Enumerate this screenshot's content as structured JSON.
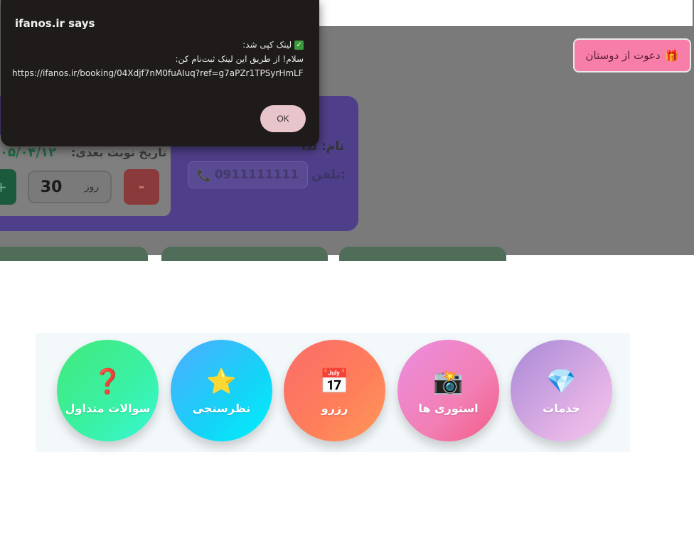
{
  "alert": {
    "title": "ifanos.ir says",
    "line1": "لینک کپی شد:",
    "line1_icon": "check-mark-icon",
    "line2": "سلام! از طریق این لینک ثبت‌نام کن:",
    "url": "https://ifanos.ir/booking/04Xdjf7nM0fuAIuq?ref=g7aPZr1TPSyrHmLF",
    "ok_label": "OK"
  },
  "invite": {
    "label": "دعوت از دوستان",
    "icon": "gift-icon"
  },
  "profile": {
    "name_label": "نام:",
    "name_value": "لدا",
    "phone_label": "تلفن:",
    "phone_value": "0911111111",
    "phone_icon": "phone-icon"
  },
  "next_appointment": {
    "label": "تاریخ نوبت بعدی:",
    "date": "۰۵/۰۴/۱۲",
    "days_value": "30",
    "days_unit": "روز",
    "minus_label": "-",
    "plus_label": "+"
  },
  "menu": {
    "items": [
      {
        "label": "خدمات",
        "icon": "gem-icon",
        "glyph": "💎"
      },
      {
        "label": "استوری ها",
        "icon": "camera-icon",
        "glyph": "📸"
      },
      {
        "label": "رزرو",
        "icon": "calendar-icon",
        "glyph": "📅"
      },
      {
        "label": "نظرسنجی",
        "icon": "star-icon",
        "glyph": "⭐"
      },
      {
        "label": "سوالات متداول",
        "icon": "question-icon",
        "glyph": "❓"
      }
    ]
  },
  "colors": {
    "overlay": "#7a7a7a",
    "alert_bg": "#1f1b1a",
    "ok_button": "#e8c4cb",
    "invite_button": "#f67ea8",
    "menu_bg": "#f3f8fa"
  }
}
